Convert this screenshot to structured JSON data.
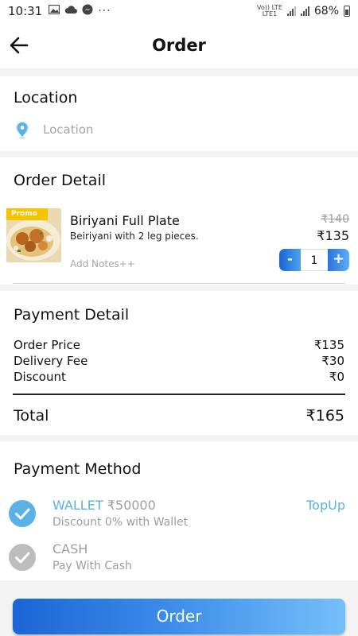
{
  "status_bar": {
    "time": "10:31",
    "icons": [
      "gallery-icon",
      "cloud-icon",
      "messenger-icon",
      "more-dots-icon"
    ],
    "network_top": "Vo)) LTE",
    "network_bottom": "LTE1",
    "battery": "68%"
  },
  "header": {
    "title": "Order",
    "back_icon": "arrow-left-icon"
  },
  "location": {
    "title": "Location",
    "placeholder": "Location",
    "icon": "location-pin-icon"
  },
  "order_detail": {
    "title": "Order Detail",
    "item": {
      "badge": "Promo",
      "name": "Biriyani Full Plate",
      "description": "Beiriyani with 2 leg pieces.",
      "notes_link": "Add Notes++",
      "old_price": "₹140",
      "price": "₹135",
      "quantity": "1",
      "minus_label": "-",
      "plus_label": "+"
    }
  },
  "payment_detail": {
    "title": "Payment Detail",
    "rows": [
      {
        "label": "Order Price",
        "value": "₹135"
      },
      {
        "label": "Delivery Fee",
        "value": "₹30"
      },
      {
        "label": "Discount",
        "value": "₹0"
      }
    ],
    "total_label": "Total",
    "total_value": "₹165"
  },
  "payment_method": {
    "title": "Payment Method",
    "options": [
      {
        "label": "WALLET",
        "amount": "₹50000",
        "sub": "Discount 0% with Wallet",
        "selected": true,
        "check_color": "#5ab1e6"
      },
      {
        "label": "CASH",
        "amount": "",
        "sub": "Pay With Cash",
        "selected": false,
        "check_color": "#bdbdbd"
      }
    ],
    "topup": "TopUp"
  },
  "order_button": "Order",
  "colors": {
    "accent": "#5ab1e6",
    "button_start": "#1c65d6",
    "button_end": "#74c0f9",
    "promo": "#f5c400"
  }
}
